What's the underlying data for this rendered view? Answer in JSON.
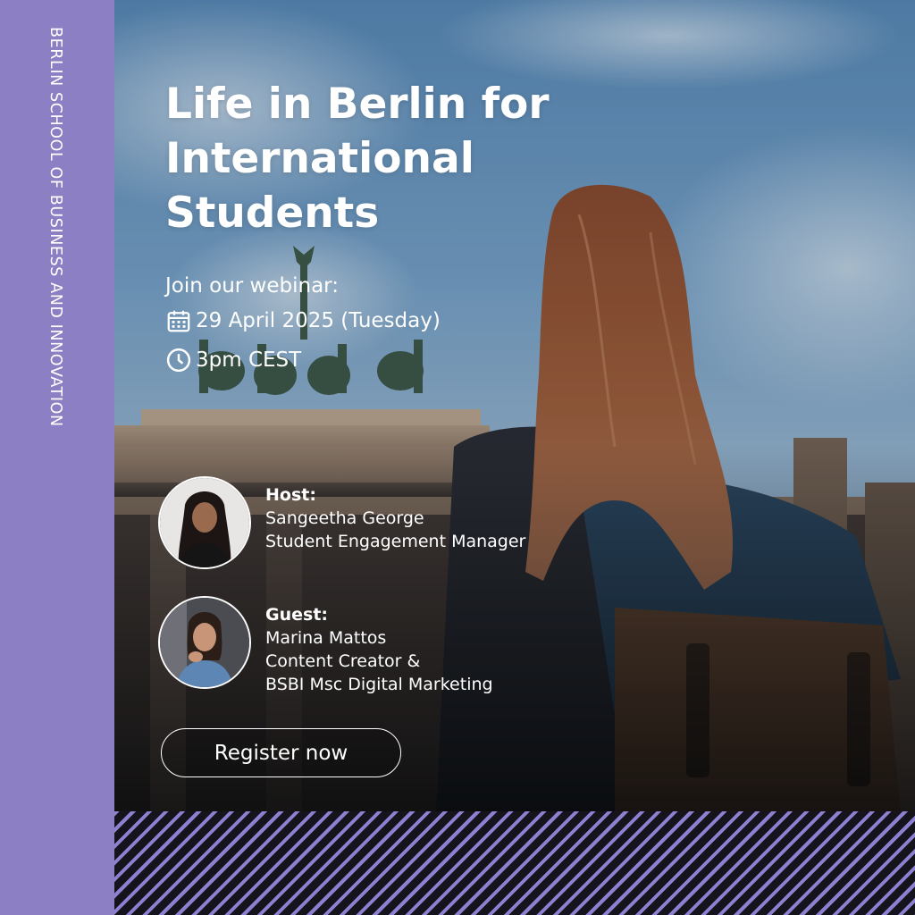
{
  "institution": "BERLIN SCHOOL OF BUSINESS AND INNOVATION",
  "title_lines": [
    "Life in Berlin for",
    "International",
    "Students"
  ],
  "webinar": {
    "intro": "Join our webinar:",
    "date": "29 April 2025 (Tuesday)",
    "time": "3pm CEST",
    "date_icon": "calendar-icon",
    "time_icon": "clock-icon"
  },
  "host": {
    "label": "Host:",
    "name": "Sangeetha George",
    "title": "Student Engagement Manager"
  },
  "guest": {
    "label": "Guest:",
    "name": "Marina Mattos",
    "title_line1": "Content Creator &",
    "title_line2": "BSBI Msc Digital Marketing"
  },
  "cta": {
    "label": "Register now"
  },
  "colors": {
    "brand_purple": "#8d7fc4",
    "stripe_purple": "#8f7fd0",
    "text": "#ffffff"
  }
}
